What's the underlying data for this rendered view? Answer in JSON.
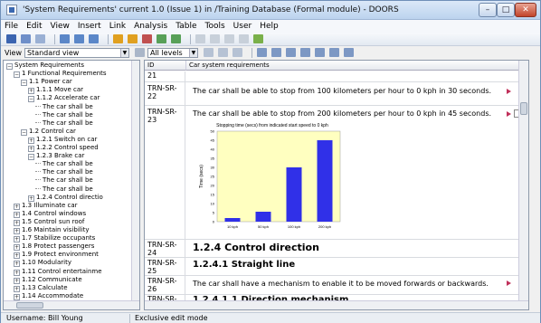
{
  "window": {
    "title": "'System Requirements' current 1.0 (Issue 1) in /Training Database (Formal module) - DOORS",
    "controls": {
      "minimize": "–",
      "maximize": "□",
      "close": "✕"
    }
  },
  "menu": [
    "File",
    "Edit",
    "View",
    "Insert",
    "Link",
    "Analysis",
    "Table",
    "Tools",
    "User",
    "Help"
  ],
  "viewbar": {
    "view_label": "View",
    "view_value": "Standard view",
    "levels_value": "All levels"
  },
  "tree": [
    {
      "label": "System Requirements",
      "toggle": "−",
      "indent": 0
    },
    {
      "label": "1 Functional Requirements",
      "toggle": "−",
      "indent": 1
    },
    {
      "label": "1.1 Power car",
      "toggle": "−",
      "indent": 2
    },
    {
      "label": "1.1.1 Move car",
      "toggle": "+",
      "indent": 3
    },
    {
      "label": "1.1.2 Accelerate car",
      "toggle": "−",
      "indent": 3
    },
    {
      "label": "The car shall be",
      "toggle": "",
      "indent": 4
    },
    {
      "label": "The car shall be",
      "toggle": "",
      "indent": 4
    },
    {
      "label": "The car shall be",
      "toggle": "",
      "indent": 4
    },
    {
      "label": "1.2 Control car",
      "toggle": "−",
      "indent": 2
    },
    {
      "label": "1.2.1 Switch on car",
      "toggle": "+",
      "indent": 3
    },
    {
      "label": "1.2.2 Control speed",
      "toggle": "+",
      "indent": 3
    },
    {
      "label": "1.2.3 Brake car",
      "toggle": "−",
      "indent": 3
    },
    {
      "label": "The car shall be",
      "toggle": "",
      "indent": 4
    },
    {
      "label": "The car shall be",
      "toggle": "",
      "indent": 4
    },
    {
      "label": "The car shall be",
      "toggle": "",
      "indent": 4
    },
    {
      "label": "The car shall be",
      "toggle": "",
      "indent": 4
    },
    {
      "label": "1.2.4 Control directio",
      "toggle": "+",
      "indent": 3
    },
    {
      "label": "1.3 Illuminate car",
      "toggle": "+",
      "indent": 1
    },
    {
      "label": "1.4 Control windows",
      "toggle": "+",
      "indent": 1
    },
    {
      "label": "1.5 Control sun roof",
      "toggle": "+",
      "indent": 1
    },
    {
      "label": "1.6 Maintain visibility",
      "toggle": "+",
      "indent": 1
    },
    {
      "label": "1.7 Stabilize occupants",
      "toggle": "+",
      "indent": 1
    },
    {
      "label": "1.8 Protect passengers",
      "toggle": "+",
      "indent": 1
    },
    {
      "label": "1.9 Protect environment",
      "toggle": "+",
      "indent": 1
    },
    {
      "label": "1.10 Modularity",
      "toggle": "+",
      "indent": 1
    },
    {
      "label": "1.11 Control entertainme",
      "toggle": "+",
      "indent": 1
    },
    {
      "label": "1.12 Communicate",
      "toggle": "+",
      "indent": 1
    },
    {
      "label": "1.13 Calculate",
      "toggle": "+",
      "indent": 1
    },
    {
      "label": "1.14 Accommodate",
      "toggle": "+",
      "indent": 1
    }
  ],
  "grid": {
    "col_id": "ID",
    "col_req": "Car system requirements",
    "rows": [
      {
        "id": "21",
        "text": ""
      },
      {
        "id": "TRN-SR-22",
        "text": "The car shall be able to stop from 100 kilometers per hour to 0 kph in 30 seconds."
      },
      {
        "id": "TRN-SR-23",
        "text": "The car shall be able to stop from 200 kilometers per hour to 0 kph in 45 seconds."
      },
      {
        "id": "TRN-SR-24",
        "heading": "1.2.4 Control direction"
      },
      {
        "id": "TRN-SR-25",
        "heading": "1.2.4.1 Straight line"
      },
      {
        "id": "TRN-SR-26",
        "text": "The car shall have a mechanism to enable it to be moved forwards or backwards."
      },
      {
        "id": "TRN-SR-",
        "heading": "1.2.4.1.1 Direction mechanism"
      }
    ]
  },
  "chart_data": {
    "type": "bar",
    "title": "Stopping time (secs) from indicated start speed to 0 kph",
    "ylabel": "Time (secs)",
    "xlabel": "",
    "categories": [
      "10 kph",
      "50 kph",
      "100 kph",
      "200 kph"
    ],
    "values": [
      2,
      5.5,
      30,
      45
    ],
    "ylim": [
      0,
      50
    ],
    "yticks": [
      0,
      5,
      10,
      15,
      20,
      25,
      30,
      35,
      40,
      45,
      50
    ],
    "grid": false,
    "plot_background": "#ffffc0",
    "bar_color": "#3030e8"
  },
  "status": {
    "user": "Username: Bill Young",
    "mode": "Exclusive edit mode"
  }
}
